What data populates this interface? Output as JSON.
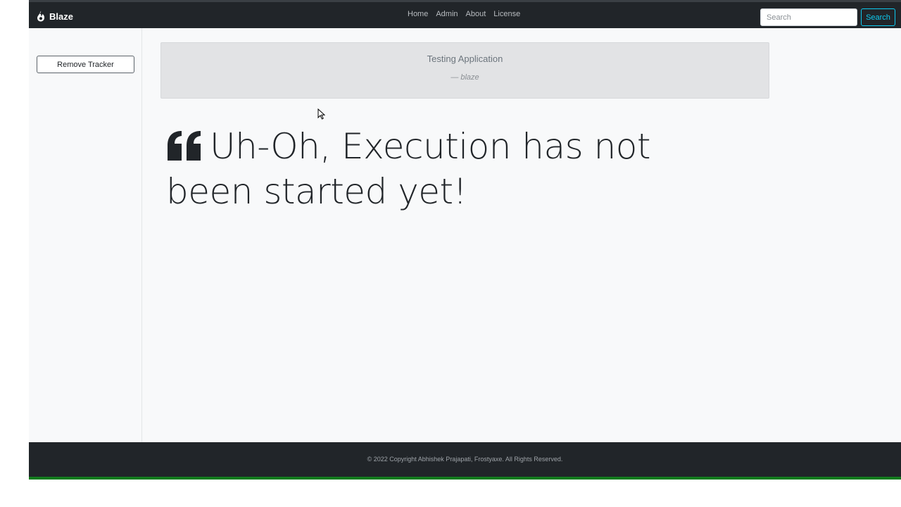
{
  "navbar": {
    "brand": "Blaze",
    "brand_icon": "fire-icon",
    "links": [
      {
        "label": "Home"
      },
      {
        "label": "Admin"
      },
      {
        "label": "About"
      },
      {
        "label": "License"
      }
    ],
    "search": {
      "placeholder": "Search",
      "value": "",
      "button_label": "Search"
    }
  },
  "sidebar": {
    "remove_tracker_label": "Remove Tracker"
  },
  "quote": {
    "text": "Testing Application",
    "author": "— blaze"
  },
  "main": {
    "message_icon": "quote-left-icon",
    "message": "Uh-Oh, Execution has not been started yet!"
  },
  "footer": {
    "copyright": "© 2022 Copyright Abhishek Prajapati, Frostyaxe. All Rights Reserved."
  },
  "colors": {
    "navbar_bg": "#212529",
    "page_bg": "#f8f9fa",
    "search_accent": "#0dcaf0",
    "footer_accent": "#127b1d",
    "quote_bg": "#e2e3e5"
  }
}
